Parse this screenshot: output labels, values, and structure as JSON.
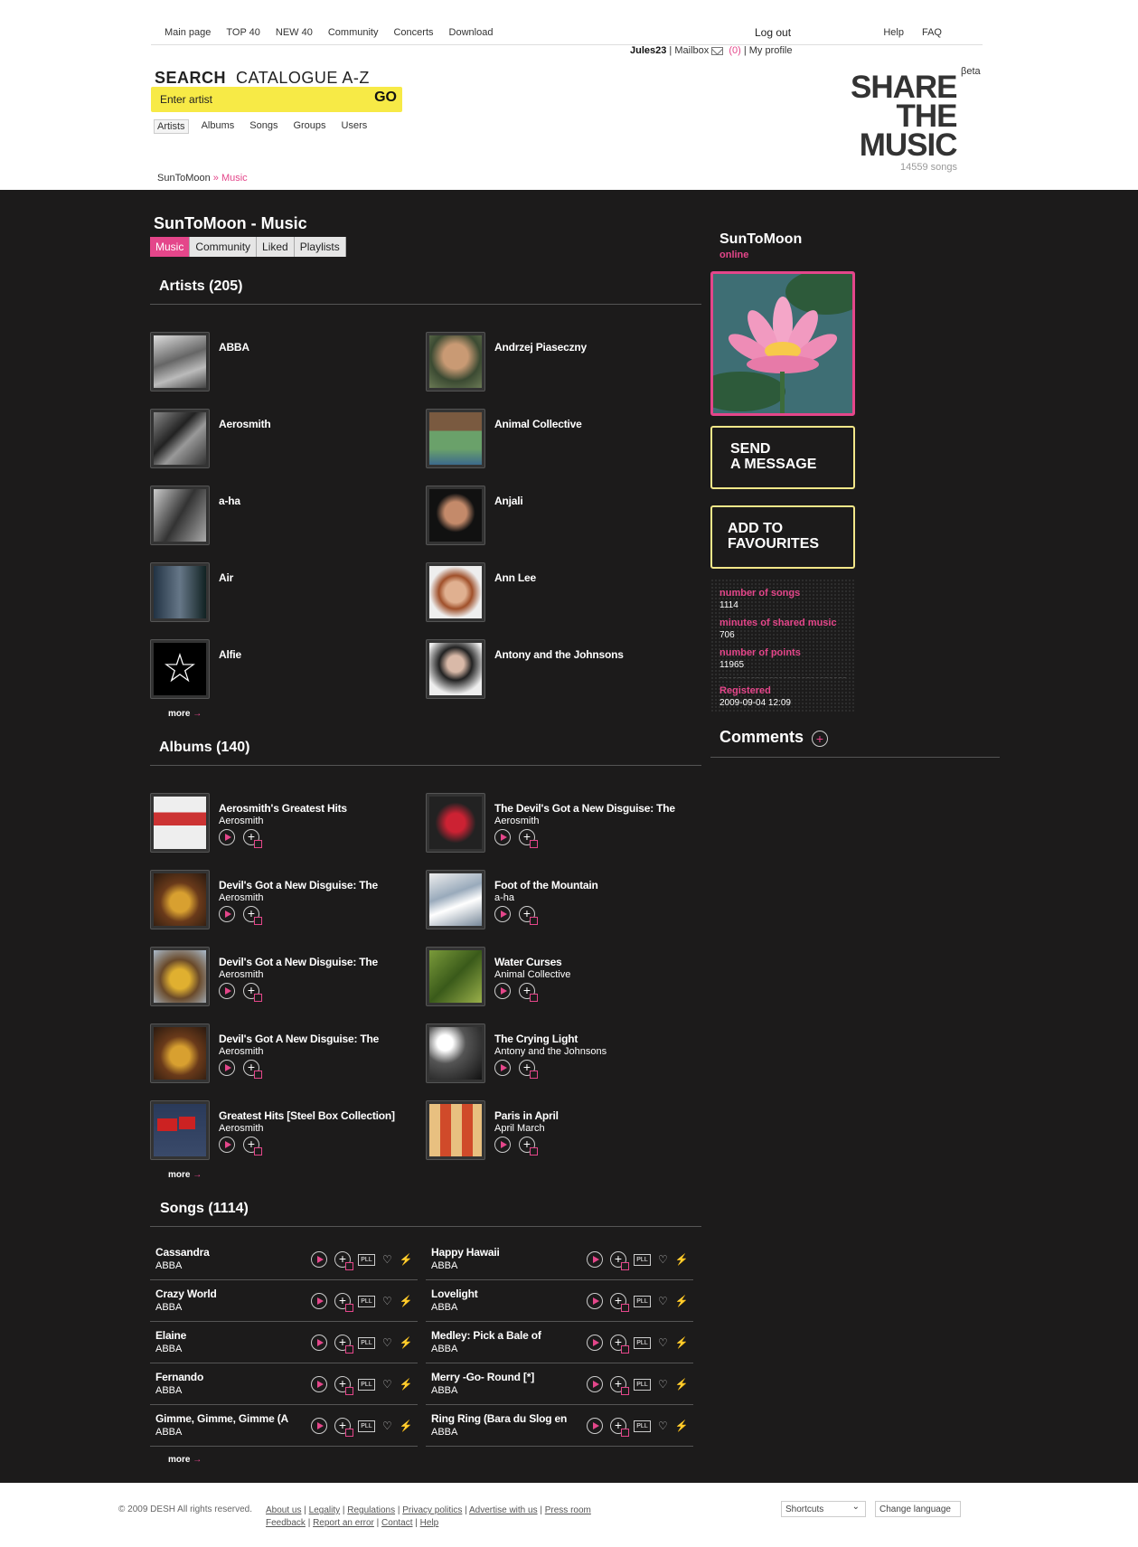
{
  "topnav": {
    "items": [
      "Main page",
      "TOP 40",
      "NEW 40",
      "Community",
      "Concerts",
      "Download"
    ],
    "logout": "Log out",
    "help": "Help",
    "faq": "FAQ"
  },
  "userbar": {
    "username": "Jules23",
    "mailbox": "Mailbox",
    "mail_count": "(0)",
    "my_profile": "My profile"
  },
  "search": {
    "title_bold": "SEARCH",
    "title_rest": "CATALOGUE A-Z",
    "placeholder": "Enter artist",
    "go": "GO",
    "tabs": [
      "Artists",
      "Albums",
      "Songs",
      "Groups",
      "Users"
    ]
  },
  "logo": {
    "line1": "SHARE",
    "line2": "THE",
    "line3": "MUSIC",
    "beta": "βeta",
    "songs": "14559 songs"
  },
  "breadcrumb": {
    "user": "SunToMoon",
    "sep": " » ",
    "current": "Music"
  },
  "page": {
    "title": "SunToMoon - Music",
    "tabs": [
      "Music",
      "Community",
      "Liked",
      "Playlists"
    ]
  },
  "artists": {
    "title": "Artists (205)",
    "items": [
      "ABBA",
      "Andrzej Piaseczny",
      "Aerosmith",
      "Animal Collective",
      "a-ha",
      "Anjali",
      "Air",
      "Ann Lee",
      "Alfie",
      "Antony and the Johnsons"
    ],
    "more": "more"
  },
  "albums": {
    "title": "Albums (140)",
    "items": [
      {
        "name": "Aerosmith's Greatest Hits",
        "artist": "Aerosmith"
      },
      {
        "name": "The Devil's Got a New Disguise: The",
        "artist": "Aerosmith"
      },
      {
        "name": "Devil's Got a New Disguise: The",
        "artist": "Aerosmith"
      },
      {
        "name": "Foot of the Mountain",
        "artist": "a-ha"
      },
      {
        "name": "Devil's Got a New Disguise: The",
        "artist": "Aerosmith"
      },
      {
        "name": "Water Curses",
        "artist": "Animal Collective"
      },
      {
        "name": "Devil's Got A New Disguise: The",
        "artist": "Aerosmith"
      },
      {
        "name": "The Crying Light",
        "artist": "Antony and the Johnsons"
      },
      {
        "name": "Greatest Hits [Steel Box Collection]",
        "artist": "Aerosmith"
      },
      {
        "name": "Paris in April",
        "artist": "April March"
      }
    ],
    "more": "more"
  },
  "songs": {
    "title": "Songs (1114)",
    "items": [
      {
        "name": "Cassandra",
        "artist": "ABBA"
      },
      {
        "name": "Happy Hawaii",
        "artist": "ABBA"
      },
      {
        "name": "Crazy World",
        "artist": "ABBA"
      },
      {
        "name": "Lovelight",
        "artist": "ABBA"
      },
      {
        "name": "Elaine",
        "artist": "ABBA"
      },
      {
        "name": "Medley: Pick a Bale of",
        "artist": "ABBA"
      },
      {
        "name": "Fernando",
        "artist": "ABBA"
      },
      {
        "name": "Merry -Go- Round [*]",
        "artist": "ABBA"
      },
      {
        "name": "Gimme, Gimme, Gimme (A",
        "artist": "ABBA"
      },
      {
        "name": "Ring Ring (Bara du Slog en",
        "artist": "ABBA"
      }
    ],
    "pll": "PLL",
    "more": "more"
  },
  "profile": {
    "name": "SunToMoon",
    "status": "online",
    "send_message": [
      "SEND",
      "A MESSAGE"
    ],
    "add_favourites": [
      "ADD TO",
      "FAVOURITES"
    ],
    "stats": {
      "songs_label": "number of songs",
      "songs": "1114",
      "minutes_label": "minutes of shared music",
      "minutes": "706",
      "points_label": "number of points",
      "points": "11965",
      "registered_label": "Registered",
      "registered": "2009-09-04 12:09"
    },
    "comments": "Comments"
  },
  "footer": {
    "copyright": "© 2009 DESH All rights reserved.",
    "links": [
      "About us",
      "Legality",
      "Regulations",
      "Privacy politics",
      "Advertise with us",
      "Press room",
      "Feedback",
      "Report an error",
      "Contact",
      "Help"
    ],
    "shortcuts": "Shortcuts",
    "change_language": "Change language"
  }
}
